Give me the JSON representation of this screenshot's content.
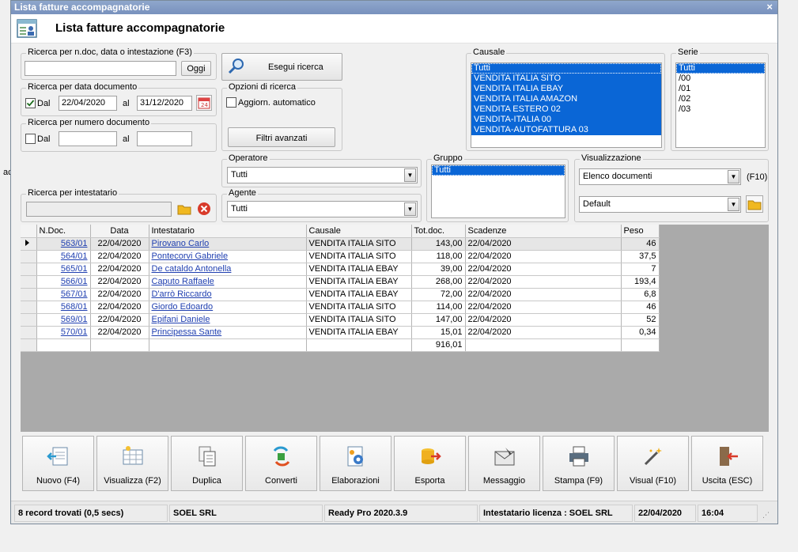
{
  "window": {
    "title": "Lista fatture accompagnatorie",
    "close_label": "×"
  },
  "header": {
    "title": "Lista fatture accompagnatorie"
  },
  "side_fragment": "ac",
  "search_text": {
    "legend": "Ricerca per n.doc, data o intestazione (F3)",
    "value": "",
    "today_button": "Oggi"
  },
  "search_date": {
    "legend": "Ricerca per data documento",
    "dal_label": "Dal",
    "checked": true,
    "from": "22/04/2020",
    "al_label": "al",
    "to": "31/12/2020"
  },
  "search_number": {
    "legend": "Ricerca per numero documento",
    "dal_label": "Dal",
    "checked": false,
    "from": "",
    "al_label": "al",
    "to": ""
  },
  "search_holder": {
    "legend": "Ricerca per intestatario",
    "value": ""
  },
  "run_search_button": "Esegui ricerca",
  "options": {
    "legend": "Opzioni di ricerca",
    "auto_update_label": "Aggiorn. automatico",
    "advanced_filters_button": "Filtri avanzati"
  },
  "operatore": {
    "legend": "Operatore",
    "value": "Tutti"
  },
  "agente": {
    "legend": "Agente",
    "value": "Tutti"
  },
  "causale": {
    "legend": "Causale",
    "items": [
      "Tutti",
      "VENDITA ITALIA SITO",
      "VENDITA ITALIA EBAY",
      "VENDITA ITALIA AMAZON",
      "VENDITA ESTERO 02",
      "VENDITA-ITALIA 00",
      "VENDITA-AUTOFATTURA 03"
    ]
  },
  "serie": {
    "legend": "Serie",
    "items": [
      "Tutti",
      "/00",
      "/01",
      "/02",
      "/03"
    ]
  },
  "gruppo": {
    "legend": "Gruppo",
    "items": [
      "Tutti"
    ]
  },
  "visualizzazione": {
    "legend": "Visualizzazione",
    "view_value": "Elenco documenti",
    "view_shortcut": "(F10)",
    "layout_value": "Default"
  },
  "grid": {
    "columns": [
      "N.Doc.",
      "Data",
      "Intestatario",
      "Causale",
      "Tot.doc.",
      "Scadenze",
      "Peso"
    ],
    "rows": [
      [
        "563/01",
        "22/04/2020",
        "Pirovano Carlo",
        "VENDITA ITALIA SITO",
        "143,00",
        "22/04/2020",
        "46"
      ],
      [
        "564/01",
        "22/04/2020",
        "Pontecorvi Gabriele",
        "VENDITA ITALIA SITO",
        "118,00",
        "22/04/2020",
        "37,5"
      ],
      [
        "565/01",
        "22/04/2020",
        "De cataldo Antonella",
        "VENDITA ITALIA EBAY",
        "39,00",
        "22/04/2020",
        "7"
      ],
      [
        "566/01",
        "22/04/2020",
        "Caputo Raffaele",
        "VENDITA ITALIA EBAY",
        "268,00",
        "22/04/2020",
        "193,4"
      ],
      [
        "567/01",
        "22/04/2020",
        "D'arrò Riccardo",
        "VENDITA ITALIA EBAY",
        "72,00",
        "22/04/2020",
        "6,8"
      ],
      [
        "568/01",
        "22/04/2020",
        "Giordo Edoardo",
        "VENDITA ITALIA SITO",
        "114,00",
        "22/04/2020",
        "46"
      ],
      [
        "569/01",
        "22/04/2020",
        "Epifani Daniele",
        "VENDITA ITALIA SITO",
        "147,00",
        "22/04/2020",
        "52"
      ],
      [
        "570/01",
        "22/04/2020",
        "Principessa Sante",
        "VENDITA ITALIA EBAY",
        "15,01",
        "22/04/2020",
        "0,34"
      ]
    ],
    "total": "916,01"
  },
  "toolbar": [
    {
      "name": "nuovo",
      "label": "Nuovo (F4)",
      "icon": "new-doc-icon"
    },
    {
      "name": "visualizza",
      "label": "Visualizza (F2)",
      "icon": "view-grid-icon"
    },
    {
      "name": "duplica",
      "label": "Duplica",
      "icon": "duplicate-icon"
    },
    {
      "name": "converti",
      "label": "Converti",
      "icon": "convert-icon"
    },
    {
      "name": "elaborazioni",
      "label": "Elaborazioni",
      "icon": "gear-doc-icon"
    },
    {
      "name": "esporta",
      "label": "Esporta",
      "icon": "export-icon"
    },
    {
      "name": "messaggio",
      "label": "Messaggio",
      "icon": "message-icon"
    },
    {
      "name": "stampa",
      "label": "Stampa (F9)",
      "icon": "printer-icon"
    },
    {
      "name": "visual",
      "label": "Visual (F10)",
      "icon": "magic-wand-icon"
    },
    {
      "name": "uscita",
      "label": "Uscita (ESC)",
      "icon": "exit-icon"
    }
  ],
  "status": {
    "records": "8 record trovati (0,5 secs)",
    "company": "SOEL SRL",
    "version": "Ready Pro 2020.3.9",
    "license": "Intestatario licenza : SOEL SRL",
    "date": "22/04/2020",
    "time": "16:04"
  },
  "colors": {
    "selection": "#0a66d6",
    "link": "#1f3fb0",
    "title_bar": "#7891bd"
  }
}
